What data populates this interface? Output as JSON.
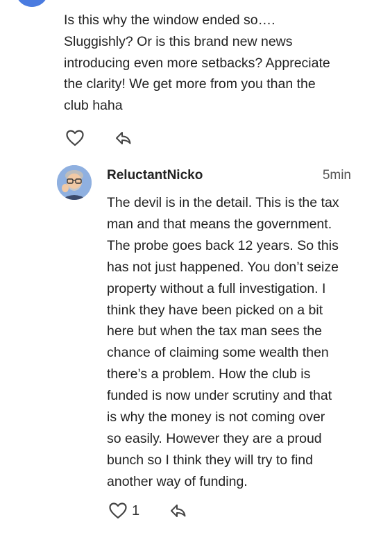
{
  "previous_comment": {
    "text": "Is this why the window ended so….\nSluggishly? Or is this brand new news\nintroducing even more setbacks? Appreciate\nthe clarity! We get more from you than the\nclub haha",
    "like_icon": "heart-outline-icon",
    "reply_icon": "reply-arrow-icon"
  },
  "comment": {
    "author": "ReluctantNicko",
    "time": "5min",
    "avatar_icon": "memoji-avatar",
    "text": "The devil is in the detail. This is the tax\nman and that means the government.\nThe probe goes back 12 years. So this\nhas not just happened. You don’t seize\nproperty without a full investigation. I\nthink they have been picked on a bit\nhere but when the tax man sees the\nchance of claiming some wealth then\nthere’s a problem. How the club is\nfunded is now under scrutiny and that\nis why the money is not coming over\nso easily. However they are a proud\nbunch so I think they will try to find\nanother way of funding.",
    "likes": "1",
    "like_icon": "heart-outline-icon",
    "reply_icon": "reply-arrow-icon"
  },
  "colors": {
    "prev_avatar_blue": "#4a7be0",
    "icon_stroke": "#444444"
  }
}
